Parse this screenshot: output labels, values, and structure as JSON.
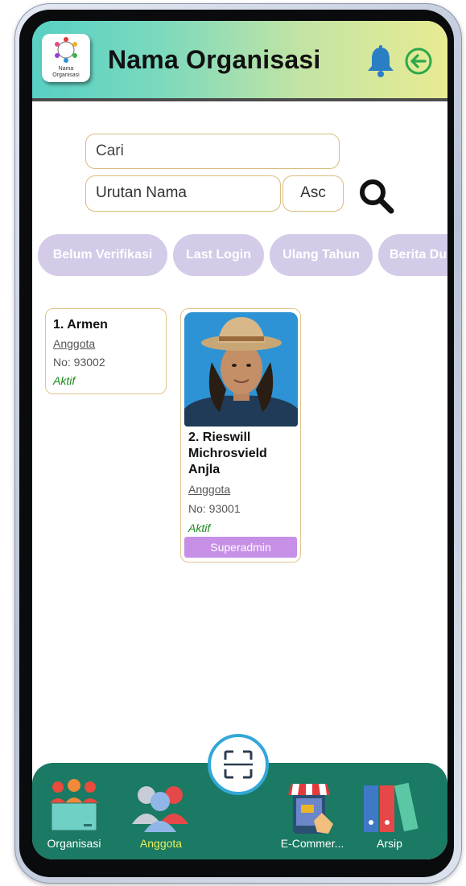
{
  "header": {
    "logo_text": "Nama\nOrganisasi",
    "title": "Nama Organisasi",
    "icons": [
      "logo-icon",
      "bell-icon",
      "back-arrow-icon"
    ]
  },
  "search": {
    "placeholder": "Cari",
    "sort_field": "Urutan Nama",
    "sort_order": "Asc",
    "icon": "search-icon"
  },
  "filters": [
    "Belum Verifikasi",
    "Last Login",
    "Ulang Tahun",
    "Berita Du"
  ],
  "members": [
    {
      "name": "1. Armen",
      "role": "Anggota",
      "number": "No: 93002",
      "status": "Aktif"
    },
    {
      "name": "2. Rieswill Michrosvield Anjla",
      "role": "Anggota",
      "number": "No: 93001",
      "status": "Aktif",
      "badge": "Superadmin",
      "photo": "member-photo"
    }
  ],
  "bottom_nav": {
    "items": [
      {
        "label": "Organisasi",
        "icon": "organization-icon"
      },
      {
        "label": "Anggota",
        "icon": "members-icon",
        "active": true
      },
      {
        "label": "E-Commer...",
        "icon": "ecommerce-icon"
      },
      {
        "label": "Arsip",
        "icon": "archive-icon"
      }
    ],
    "scan_icon": "scan-icon"
  },
  "colors": {
    "header_gradient_start": "#58d0c4",
    "header_gradient_end": "#e8eb92",
    "chip_background": "#d3cbe8",
    "field_border": "#d8bc7e",
    "status_active": "#1c8a1c",
    "badge": "#c690e6",
    "nav_background": "#1a7a63",
    "nav_active_label": "#e7ef5a",
    "scan_ring": "#33a7d8"
  }
}
